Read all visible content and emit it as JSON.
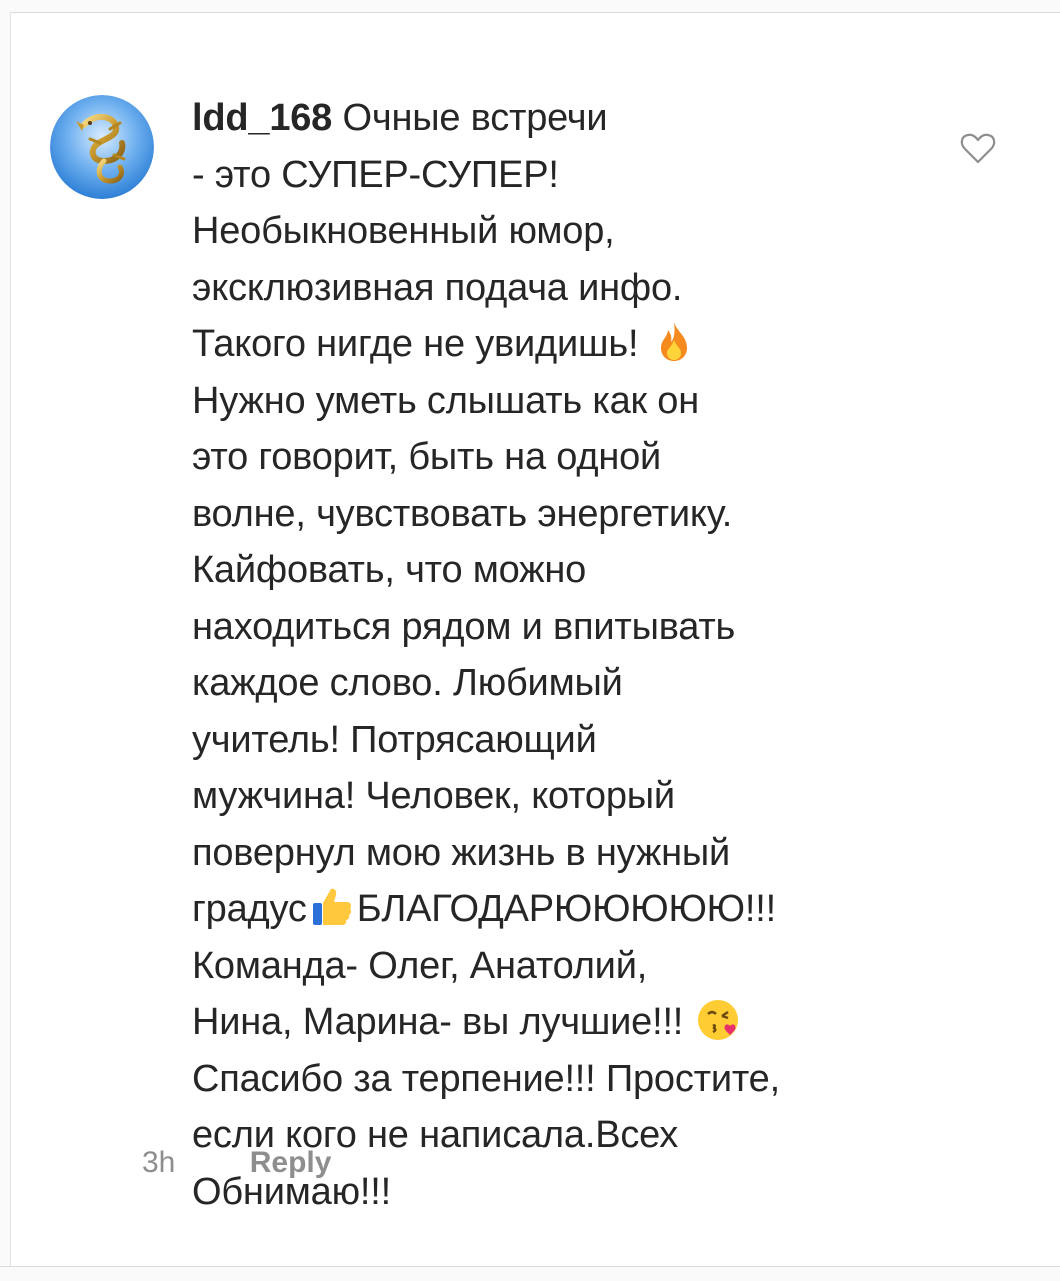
{
  "comment": {
    "username": "ldd_168",
    "lines": [
      " Очные встречи",
      "- это СУПЕР-СУПЕР!",
      "Необыкновенный юмор,",
      "эксклюзивная подача инфо.",
      "Такого нигде не увидишь!",
      "Нужно уметь слышать как он",
      "это говорит, быть на одной",
      "волне, чувствовать энергетику.",
      "Кайфовать, что можно",
      "находиться рядом и впитывать",
      "каждое слово. Любимый",
      "учитель! Потрясающий",
      "мужчина! Человек, который",
      "повернул мою жизнь в нужный",
      "градус",
      "БЛАГОДАРЮЮЮЮЮ!!!",
      "Команда- Олег, Анатолий,",
      "Нина, Марина- вы лучшие!!!",
      "Спасибо за терпение!!! Простите,",
      "если кого не написала.Всех",
      "Обнимаю!!!"
    ],
    "emojis": {
      "line5": "fire-emoji",
      "line15": "thumbs-up-emoji",
      "line18": "kissing-face-emoji"
    },
    "time": "3h",
    "reply_label": "Reply",
    "like_icon": "heart-outline-icon",
    "avatar_icon": "golden-dragon-avatar"
  },
  "colors": {
    "text": "#262626",
    "meta": "#8e8e8e",
    "avatar_bg": "#3d8fe0"
  }
}
